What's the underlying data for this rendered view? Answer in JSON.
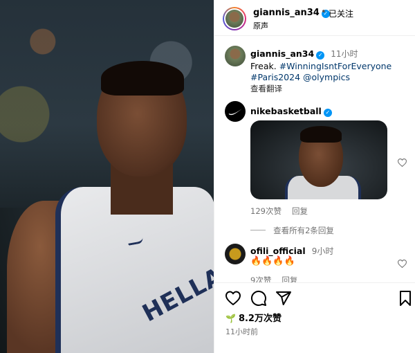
{
  "header": {
    "username": "giannis_an34",
    "dot": "•",
    "follow_status": "已关注",
    "audio": "原声"
  },
  "caption": {
    "username": "giannis_an34",
    "time": "11小时",
    "text": "Freak.",
    "hashtag1": "#WinningIsntForEveryone",
    "hashtag2": "#Paris2024",
    "mention": "@olympics",
    "translate": "查看翻译"
  },
  "comment1": {
    "username": "nikebasketball",
    "likes": "129次赞",
    "reply": "回复",
    "view_replies": "查看所有2条回复"
  },
  "comment2": {
    "username": "ofili_official",
    "time": "9小时",
    "text": "🔥🔥🔥🔥",
    "likes_partial": "9次赞",
    "reply_partial": "回复"
  },
  "footer": {
    "likes": "8.2万次赞",
    "posted": "11小时前"
  },
  "media": {
    "jersey_text": "HELLAS"
  },
  "colors": {
    "verified": "#0095f6",
    "link": "#00376b",
    "muted": "#737373"
  },
  "icons": {
    "like": "heart-icon",
    "comment": "comment-icon",
    "share": "share-icon",
    "save": "bookmark-icon"
  }
}
